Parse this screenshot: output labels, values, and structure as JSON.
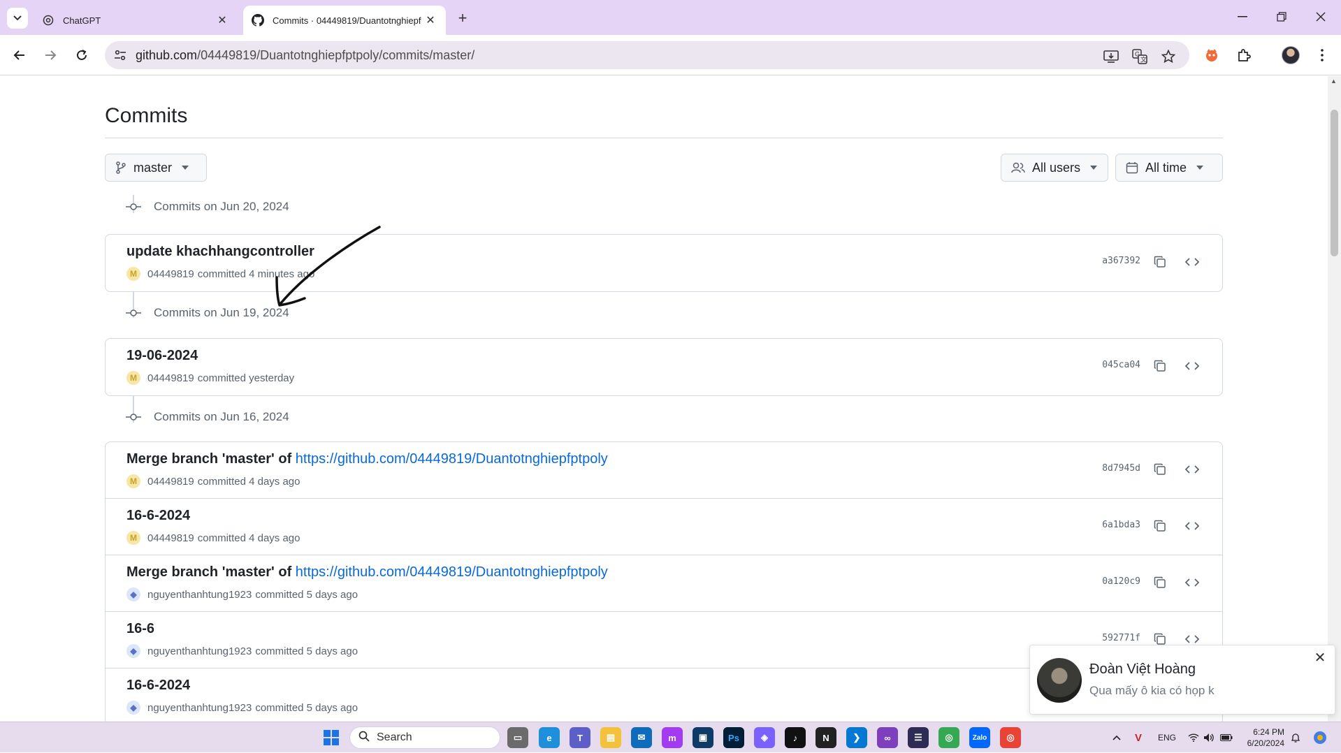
{
  "browser": {
    "tabs": [
      {
        "title": "ChatGPT",
        "favicon": "chatgpt-icon",
        "active": false
      },
      {
        "title": "Commits · 04449819/Duantotnghiepf",
        "favicon": "github-icon",
        "active": true
      }
    ],
    "url_host": "github.com",
    "url_path": "/04449819/Duantotnghiepfptpoly/commits/master/"
  },
  "page": {
    "title": "Commits",
    "branch_label": "master",
    "users_filter": "All users",
    "time_filter": "All time"
  },
  "groups": [
    {
      "heading": "Commits on Jun 20, 2024",
      "commits": [
        {
          "message": "update khachhangcontroller",
          "link": "",
          "author": "04449819",
          "when": "committed 4 minutes ago",
          "sha": "a367392",
          "avatar": "gold"
        }
      ]
    },
    {
      "heading": "Commits on Jun 19, 2024",
      "commits": [
        {
          "message": "19-06-2024",
          "link": "",
          "author": "04449819",
          "when": "committed yesterday",
          "sha": "045ca04",
          "avatar": "gold"
        }
      ]
    },
    {
      "heading": "Commits on Jun 16, 2024",
      "commits": [
        {
          "message": "Merge branch 'master' of ",
          "link": "https://github.com/04449819/Duantotnghiepfptpoly",
          "author": "04449819",
          "when": "committed 4 days ago",
          "sha": "8d7945d",
          "avatar": "gold"
        },
        {
          "message": "16-6-2024",
          "link": "",
          "author": "04449819",
          "when": "committed 4 days ago",
          "sha": "6a1bda3",
          "avatar": "gold"
        },
        {
          "message": "Merge branch 'master' of ",
          "link": "https://github.com/04449819/Duantotnghiepfptpoly",
          "author": "nguyenthanhtung1923",
          "when": "committed 5 days ago",
          "sha": "0a120c9",
          "avatar": "blue"
        },
        {
          "message": "16-6",
          "link": "",
          "author": "nguyenthanhtung1923",
          "when": "committed 5 days ago",
          "sha": "592771f",
          "avatar": "blue"
        },
        {
          "message": "16-6-2024",
          "link": "",
          "author": "nguyenthanhtung1923",
          "when": "committed 5 days ago",
          "sha": "",
          "avatar": "blue"
        }
      ]
    }
  ],
  "toast": {
    "name": "Đoàn Việt Hoàng",
    "message": "Qua mấy ô kia có họp k"
  },
  "taskbar": {
    "search_label": "Search",
    "lang": "ENG",
    "time": "6:24 PM",
    "date": "6/20/2024"
  }
}
